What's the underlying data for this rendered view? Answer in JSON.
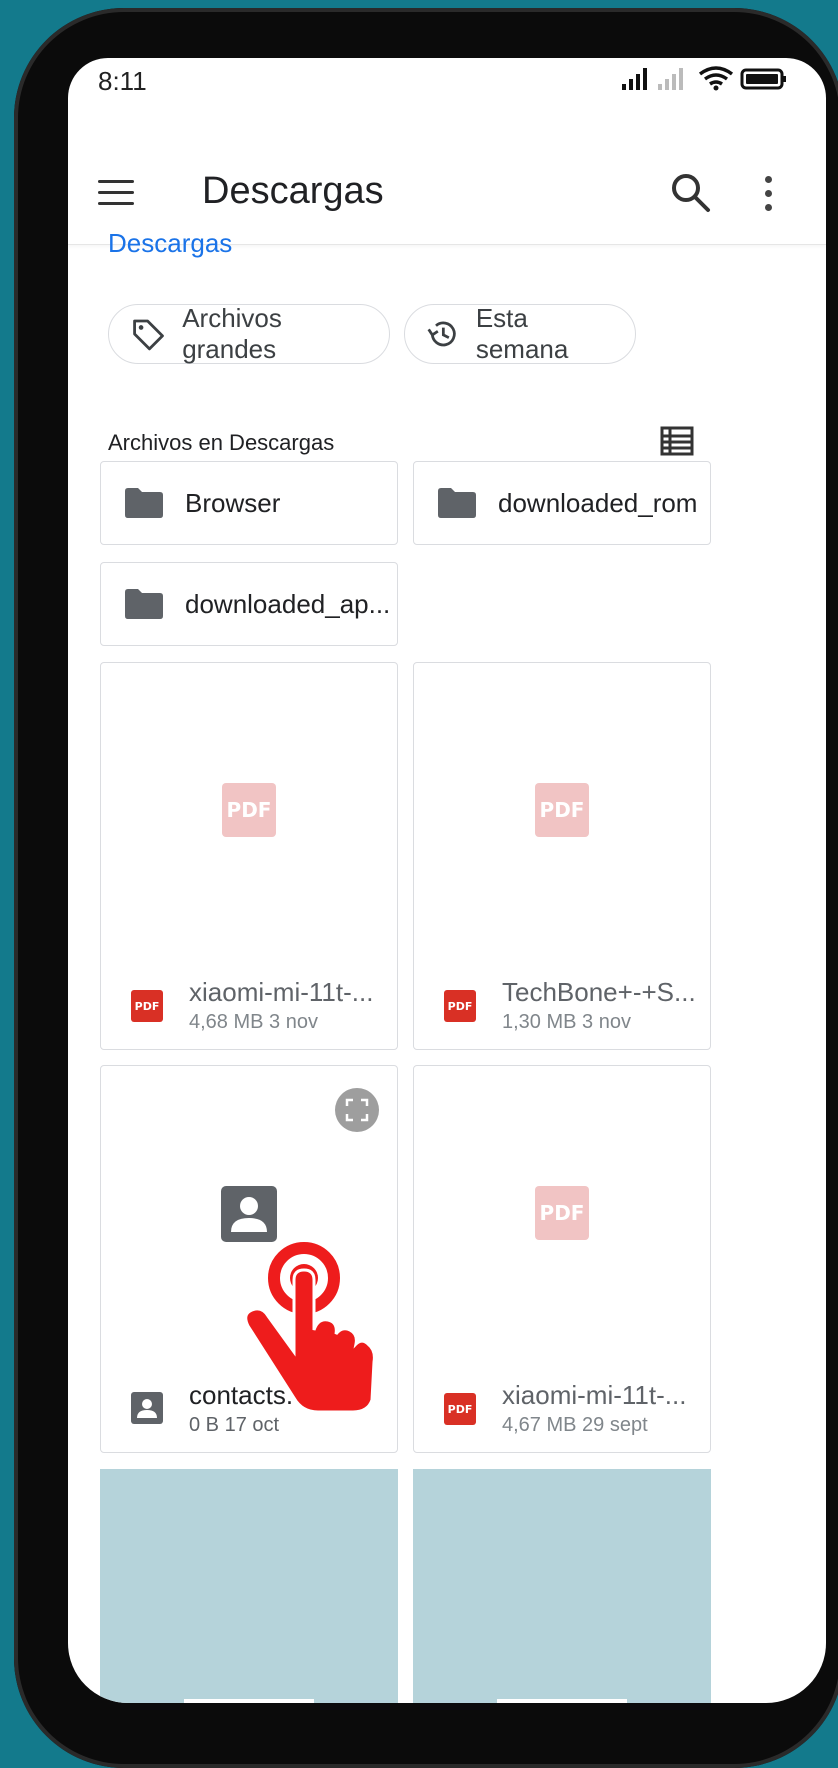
{
  "status": {
    "time": "8:11"
  },
  "appbar": {
    "title": "Descargas"
  },
  "breadcrumb": "Descargas",
  "chips": [
    {
      "label": "Archivos grandes",
      "icon": "tag-icon"
    },
    {
      "label": "Esta semana",
      "icon": "history-icon"
    }
  ],
  "section": {
    "title": "Archivos en Descargas"
  },
  "folders": [
    {
      "label": "Browser"
    },
    {
      "label": "downloaded_rom"
    },
    {
      "label": "downloaded_ap..."
    }
  ],
  "files": [
    {
      "name": "xiaomi-mi-11t-...",
      "meta": "4,68 MB 3 nov",
      "type": "PDF"
    },
    {
      "name": "TechBone+-+S...",
      "meta": "1,30 MB 3 nov",
      "type": "PDF"
    },
    {
      "name": "contacts.vcf",
      "meta": "0 B 17 oct",
      "type": "contact"
    },
    {
      "name": "xiaomi-mi-11t-...",
      "meta": "4,67 MB 29 sept",
      "type": "PDF"
    }
  ],
  "colors": {
    "accent": "#1a73e8",
    "pdf_red": "#d93025",
    "background": "#137a8c",
    "hand": "#ee1c1c"
  }
}
